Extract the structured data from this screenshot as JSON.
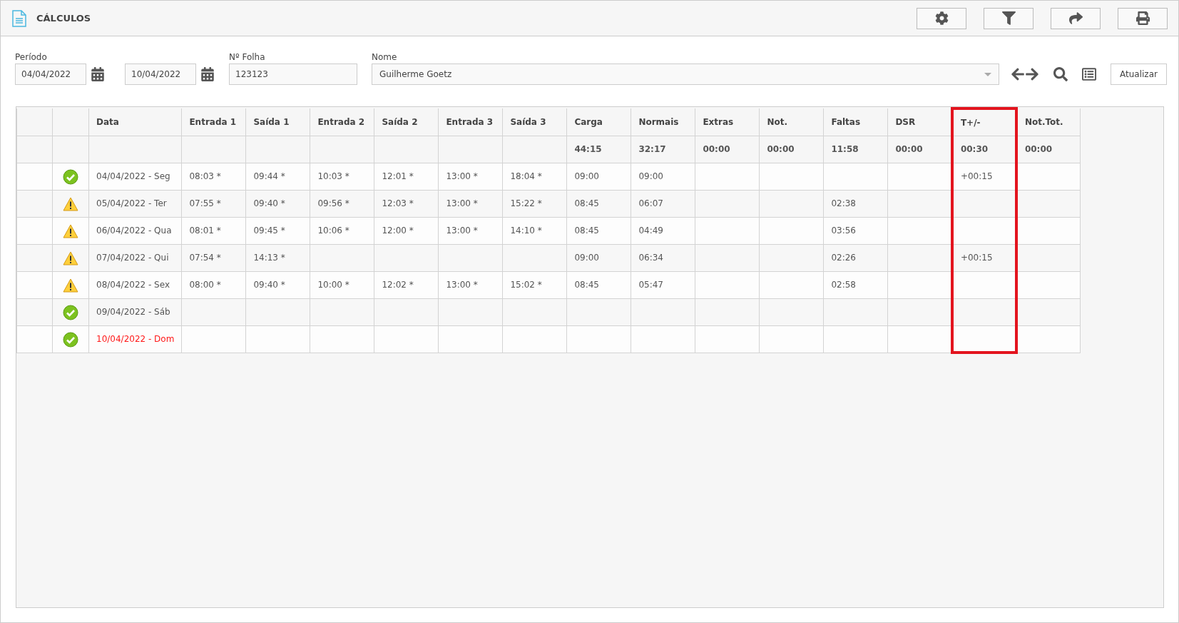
{
  "header": {
    "title": "CÁLCULOS"
  },
  "filters": {
    "period_label": "Período",
    "start_date": "04/04/2022",
    "end_date": "10/04/2022",
    "sheet_label": "Nº Folha",
    "sheet_number": "123123",
    "name_label": "Nome",
    "name": "Guilherme Goetz",
    "refresh_button": "Atualizar"
  },
  "table": {
    "columns": [
      {
        "highlighted": false
      },
      {
        "highlighted": false
      },
      {
        "label": "Data",
        "highlighted": false
      },
      {
        "label": "Entrada 1",
        "highlighted": false
      },
      {
        "label": "Saída 1",
        "highlighted": false
      },
      {
        "label": "Entrada 2",
        "highlighted": false
      },
      {
        "label": "Saída 2",
        "highlighted": false
      },
      {
        "label": "Entrada 3",
        "highlighted": false
      },
      {
        "label": "Saída 3",
        "highlighted": false
      },
      {
        "label": "Carga",
        "total": "44:15",
        "highlighted": false
      },
      {
        "label": "Normais",
        "total": "32:17",
        "highlighted": false
      },
      {
        "label": "Extras",
        "total": "00:00",
        "highlighted": false
      },
      {
        "label": "Not.",
        "total": "00:00",
        "highlighted": false
      },
      {
        "label": "Faltas",
        "total": "11:58",
        "highlighted": false
      },
      {
        "label": "DSR",
        "total": "00:00",
        "highlighted": false
      },
      {
        "label": "T+/-",
        "total": "00:30",
        "highlighted": true
      },
      {
        "label": "Not.Tot.",
        "total": "00:00",
        "highlighted": false
      }
    ],
    "rows": [
      {
        "kind": "ok",
        "color": "#555555",
        "cells": [
          null,
          null,
          "04/04/2022 - Seg",
          "08:03 *",
          "09:44 *",
          "10:03 *",
          "12:01 *",
          "13:00 *",
          "18:04 *",
          "09:00",
          "09:00",
          null,
          null,
          null,
          null,
          "+00:15",
          null
        ]
      },
      {
        "kind": "warning",
        "color": "#555555",
        "cells": [
          null,
          null,
          "05/04/2022 - Ter",
          "07:55 *",
          "09:40 *",
          "09:56 *",
          "12:03 *",
          "13:00 *",
          "15:22 *",
          "08:45",
          "06:07",
          null,
          null,
          "02:38",
          null,
          null,
          null
        ]
      },
      {
        "kind": "warning",
        "color": "#555555",
        "cells": [
          null,
          null,
          "06/04/2022 - Qua",
          "08:01 *",
          "09:45 *",
          "10:06 *",
          "12:00 *",
          "13:00 *",
          "14:10 *",
          "08:45",
          "04:49",
          null,
          null,
          "03:56",
          null,
          null,
          null
        ]
      },
      {
        "kind": "warning",
        "color": "#555555",
        "cells": [
          null,
          null,
          "07/04/2022 - Qui",
          "07:54 *",
          "14:13 *",
          null,
          null,
          null,
          null,
          "09:00",
          "06:34",
          null,
          null,
          "02:26",
          null,
          "+00:15",
          null
        ]
      },
      {
        "kind": "warning",
        "color": "#555555",
        "cells": [
          null,
          null,
          "08/04/2022 - Sex",
          "08:00 *",
          "09:40 *",
          "10:00 *",
          "12:02 *",
          "13:00 *",
          "15:02 *",
          "08:45",
          "05:47",
          null,
          null,
          "02:58",
          null,
          null,
          null
        ]
      },
      {
        "kind": "ok",
        "color": "#555555",
        "cells": [
          null,
          null,
          "09/04/2022 - Sáb",
          null,
          null,
          null,
          null,
          null,
          null,
          null,
          null,
          null,
          null,
          null,
          null,
          null,
          null
        ]
      },
      {
        "kind": "ok",
        "color": "#ff1a1a",
        "cells": [
          null,
          null,
          "10/04/2022 - Dom",
          null,
          null,
          null,
          null,
          null,
          null,
          null,
          null,
          null,
          null,
          null,
          null,
          null,
          null
        ]
      }
    ]
  }
}
